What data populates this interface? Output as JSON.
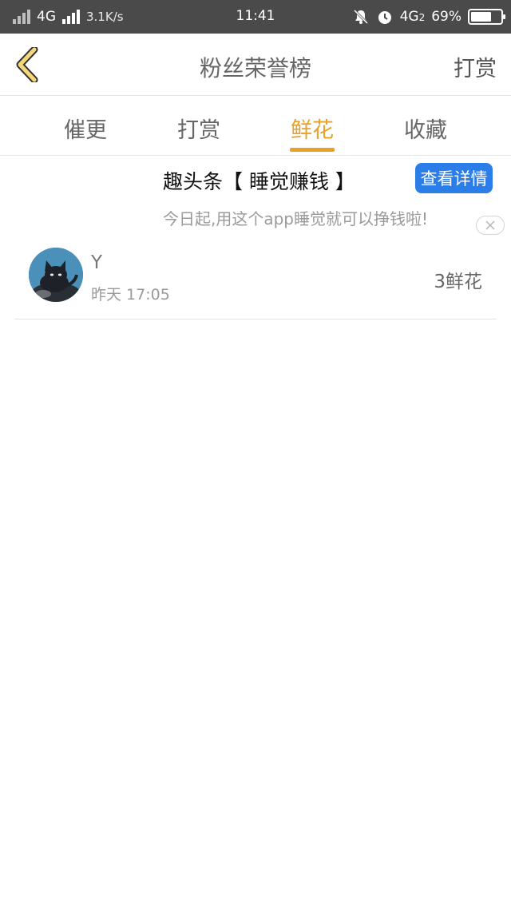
{
  "status_bar": {
    "network": "4G",
    "speed": "3.1K/s",
    "time": "11:41",
    "network2": "4G",
    "network2_sub": "2",
    "battery": "69%",
    "battery_level": 0.69
  },
  "header": {
    "title": "粉丝荣誉榜",
    "right_action": "打赏"
  },
  "tabs": [
    {
      "label": "催更",
      "active": false
    },
    {
      "label": "打赏",
      "active": false
    },
    {
      "label": "鲜花",
      "active": true
    },
    {
      "label": "收藏",
      "active": false
    }
  ],
  "ad": {
    "title": "趣头条【 睡觉赚钱 】",
    "button": "查看详情",
    "description": "今日起,用这个app睡觉就可以挣钱啦!"
  },
  "list": [
    {
      "name": "Y",
      "time": "昨天 17:05",
      "count": "3鲜花"
    }
  ],
  "colors": {
    "accent": "#e8a028",
    "ad_button": "#2b7de9",
    "status_bar": "#4a4a4a"
  }
}
